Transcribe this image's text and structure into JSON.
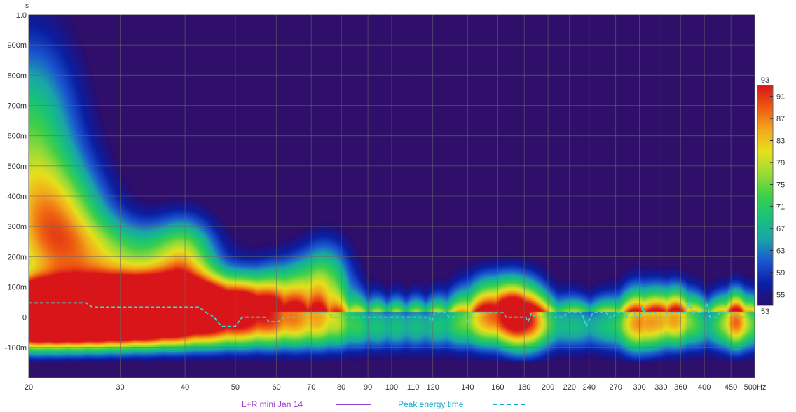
{
  "chart_data": {
    "type": "heatmap",
    "x_scale": "log",
    "x_unit": "Hz",
    "y_unit": "s",
    "xlim": [
      20,
      500
    ],
    "ylim": [
      -0.2,
      1.0
    ],
    "x_ticks": [
      {
        "value": 20,
        "label": "20",
        "bold": true
      },
      {
        "value": 30,
        "label": "30",
        "bold": true
      },
      {
        "value": 40,
        "label": "40",
        "bold": true
      },
      {
        "value": 50,
        "label": "50",
        "bold": true
      },
      {
        "value": 60,
        "label": "60",
        "bold": true
      },
      {
        "value": 70,
        "label": "70",
        "bold": true
      },
      {
        "value": 80,
        "label": "80",
        "bold": true
      },
      {
        "value": 90,
        "label": "90",
        "bold": true
      },
      {
        "value": 100,
        "label": "100",
        "bold": true
      },
      {
        "value": 110,
        "label": "110",
        "bold": false
      },
      {
        "value": 120,
        "label": "120",
        "bold": false
      },
      {
        "value": 140,
        "label": "140",
        "bold": false
      },
      {
        "value": 160,
        "label": "160",
        "bold": false
      },
      {
        "value": 180,
        "label": "180",
        "bold": false
      },
      {
        "value": 200,
        "label": "200",
        "bold": true
      },
      {
        "value": 220,
        "label": "220",
        "bold": false
      },
      {
        "value": 240,
        "label": "240",
        "bold": false
      },
      {
        "value": 270,
        "label": "270",
        "bold": false
      },
      {
        "value": 300,
        "label": "300",
        "bold": true
      },
      {
        "value": 330,
        "label": "330",
        "bold": false
      },
      {
        "value": 360,
        "label": "360",
        "bold": false
      },
      {
        "value": 400,
        "label": "400",
        "bold": true
      },
      {
        "value": 450,
        "label": "450",
        "bold": false
      },
      {
        "value": 500,
        "label": "500",
        "bold": true
      }
    ],
    "y_ticks": [
      {
        "value": 1.0,
        "label": "1.0"
      },
      {
        "value": 0.9,
        "label": "900m"
      },
      {
        "value": 0.8,
        "label": "800m"
      },
      {
        "value": 0.7,
        "label": "700m"
      },
      {
        "value": 0.6,
        "label": "600m"
      },
      {
        "value": 0.5,
        "label": "500m"
      },
      {
        "value": 0.4,
        "label": "400m"
      },
      {
        "value": 0.3,
        "label": "300m"
      },
      {
        "value": 0.2,
        "label": "200m"
      },
      {
        "value": 0.1,
        "label": "100m"
      },
      {
        "value": 0.0,
        "label": "0"
      },
      {
        "value": -0.1,
        "label": "-100m"
      }
    ],
    "grid": true,
    "colorbar": {
      "range": [
        53,
        93
      ],
      "ticks": [
        93,
        91,
        87,
        83,
        79,
        75,
        71,
        67,
        63,
        59,
        55,
        53
      ],
      "colors": [
        "#2a0d6e",
        "#0a1fa3",
        "#1a55d0",
        "#1aa4a8",
        "#18c27a",
        "#3ecf4a",
        "#9adb36",
        "#e6e01a",
        "#f2a81c",
        "#ee5a12",
        "#d8161a"
      ]
    },
    "background_color": "#2f0f6a",
    "heatmap_components": [
      {
        "f": 20,
        "fw": 0.2,
        "t": 0.04,
        "tw": 0.065,
        "a": 1.0
      },
      {
        "f": 27,
        "fw": 0.24,
        "t": 0.05,
        "tw": 0.09,
        "a": 0.85
      },
      {
        "f": 36,
        "fw": 0.13,
        "t": 0.06,
        "tw": 0.09,
        "a": 0.65
      },
      {
        "f": 20,
        "fw": 0.1,
        "t": 0.55,
        "tw": 0.38,
        "a": 0.55
      },
      {
        "f": 23,
        "fw": 0.1,
        "t": 0.3,
        "tw": 0.2,
        "a": 0.55
      },
      {
        "f": 30,
        "fw": 0.15,
        "t": 0.2,
        "tw": 0.12,
        "a": 0.45
      },
      {
        "f": 40,
        "fw": 0.06,
        "t": 0.2,
        "tw": 0.14,
        "a": 0.45
      },
      {
        "f": 22,
        "fw": 0.35,
        "t": -0.05,
        "tw": 0.06,
        "a": 0.7
      },
      {
        "f": 52,
        "fw": 0.08,
        "t": 0.05,
        "tw": 0.09,
        "a": 0.4
      },
      {
        "f": 64,
        "fw": 0.08,
        "t": 0.08,
        "tw": 0.13,
        "a": 0.4
      },
      {
        "f": 75,
        "fw": 0.05,
        "t": 0.12,
        "tw": 0.15,
        "a": 0.4
      },
      {
        "f": 160,
        "fw": 0.07,
        "t": 0.04,
        "tw": 0.11,
        "a": 0.6
      },
      {
        "f": 180,
        "fw": 0.04,
        "t": 0.0,
        "tw": 0.12,
        "a": 0.45
      },
      {
        "f": 300,
        "fw": 0.04,
        "t": 0.0,
        "tw": 0.12,
        "a": 0.45
      },
      {
        "f": 350,
        "fw": 0.04,
        "t": 0.02,
        "tw": 0.1,
        "a": 0.45
      },
      {
        "f": 460,
        "fw": 0.03,
        "t": 0.0,
        "tw": 0.1,
        "a": 0.5
      }
    ],
    "peak_energy_time": {
      "name": "Peak energy time",
      "color": "#3dd6d0",
      "points": [
        [
          20,
          0.047
        ],
        [
          25.8,
          0.047
        ],
        [
          26.5,
          0.033
        ],
        [
          42.5,
          0.033
        ],
        [
          44,
          0.015
        ],
        [
          45.5,
          0.0
        ],
        [
          47,
          -0.03
        ],
        [
          50,
          -0.03
        ],
        [
          51.5,
          0.0
        ],
        [
          57,
          0.0
        ],
        [
          58,
          -0.015
        ],
        [
          60.5,
          -0.015
        ],
        [
          62,
          0.0
        ],
        [
          67,
          0.0
        ],
        [
          68.5,
          0.015
        ],
        [
          75,
          0.015
        ],
        [
          77.5,
          0.0
        ],
        [
          118,
          0.0
        ],
        [
          119.5,
          -0.015
        ],
        [
          121,
          0.015
        ],
        [
          127,
          0.015
        ],
        [
          129,
          0.0
        ],
        [
          138,
          0.0
        ],
        [
          140,
          -0.015
        ],
        [
          143,
          0.015
        ],
        [
          164,
          0.015
        ],
        [
          166,
          0.0
        ],
        [
          181,
          0.0
        ],
        [
          183,
          -0.015
        ],
        [
          186,
          0.015
        ],
        [
          189,
          0.0
        ],
        [
          215,
          0.0
        ],
        [
          217,
          0.015
        ],
        [
          232,
          0.015
        ],
        [
          237,
          -0.03
        ],
        [
          244,
          0.015
        ],
        [
          259,
          0.015
        ],
        [
          262,
          0.0
        ],
        [
          267,
          0.0
        ],
        [
          270,
          0.015
        ],
        [
          282,
          0.015
        ],
        [
          284,
          0.0
        ],
        [
          292,
          0.0
        ],
        [
          294,
          0.015
        ],
        [
          297,
          0.0
        ],
        [
          301,
          0.0
        ],
        [
          304,
          0.03
        ],
        [
          307,
          0.015
        ],
        [
          322,
          0.015
        ],
        [
          325,
          0.0
        ],
        [
          336,
          0.0
        ],
        [
          339,
          0.015
        ],
        [
          365,
          0.015
        ],
        [
          373,
          0.047
        ],
        [
          381,
          0.015
        ],
        [
          396,
          0.015
        ],
        [
          405,
          0.047
        ],
        [
          410,
          0.0
        ],
        [
          422,
          0.0
        ],
        [
          428,
          0.015
        ],
        [
          455,
          0.015
        ],
        [
          458,
          0.0
        ],
        [
          500,
          0.0
        ]
      ]
    },
    "legend": {
      "placement": "bottom",
      "items": [
        {
          "label": "L+R mini Jan 14",
          "color": "#9b3fcf",
          "style": "solid"
        },
        {
          "label": "Peak energy time",
          "color": "#1aa8c8",
          "style": "dashed"
        }
      ]
    }
  }
}
